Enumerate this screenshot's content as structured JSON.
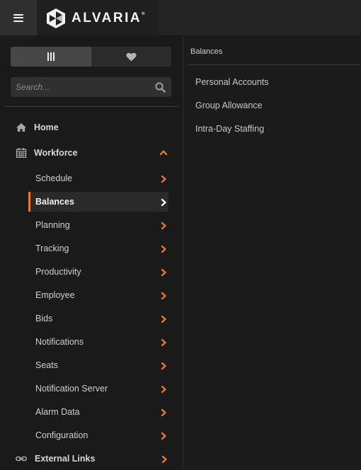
{
  "header": {
    "menu_icon": "hamburger-menu-icon",
    "brand": {
      "name": "ALVARIA",
      "trademark": "®",
      "icon": "alvaria-logo-icon"
    }
  },
  "sidebar": {
    "toggle": [
      {
        "icon": "columns-icon",
        "active": true
      },
      {
        "icon": "heart-icon",
        "active": false
      }
    ],
    "search": {
      "placeholder": "Search...",
      "value": "",
      "icon": "search-icon"
    },
    "items": [
      {
        "label": "Home",
        "icon": "home-icon"
      },
      {
        "label": "Workforce",
        "icon": "calendar-icon",
        "expanded": true
      },
      {
        "label": "External Links",
        "icon": "link-icon"
      }
    ],
    "workforce_children": [
      {
        "label": "Schedule"
      },
      {
        "label": "Balances",
        "active": true
      },
      {
        "label": "Planning"
      },
      {
        "label": "Tracking"
      },
      {
        "label": "Productivity"
      },
      {
        "label": "Employee"
      },
      {
        "label": "Bids"
      },
      {
        "label": "Notifications"
      },
      {
        "label": "Seats"
      },
      {
        "label": "Notification Server"
      },
      {
        "label": "Alarm Data"
      },
      {
        "label": "Configuration"
      }
    ]
  },
  "main": {
    "breadcrumb": "Balances",
    "links": [
      "Personal Accounts",
      "Group Allowance",
      "Intra-Day Staffing"
    ]
  },
  "colors": {
    "accent": "#e8782a",
    "active_chevron": "#ffffff",
    "background": "#1c1c1c"
  }
}
